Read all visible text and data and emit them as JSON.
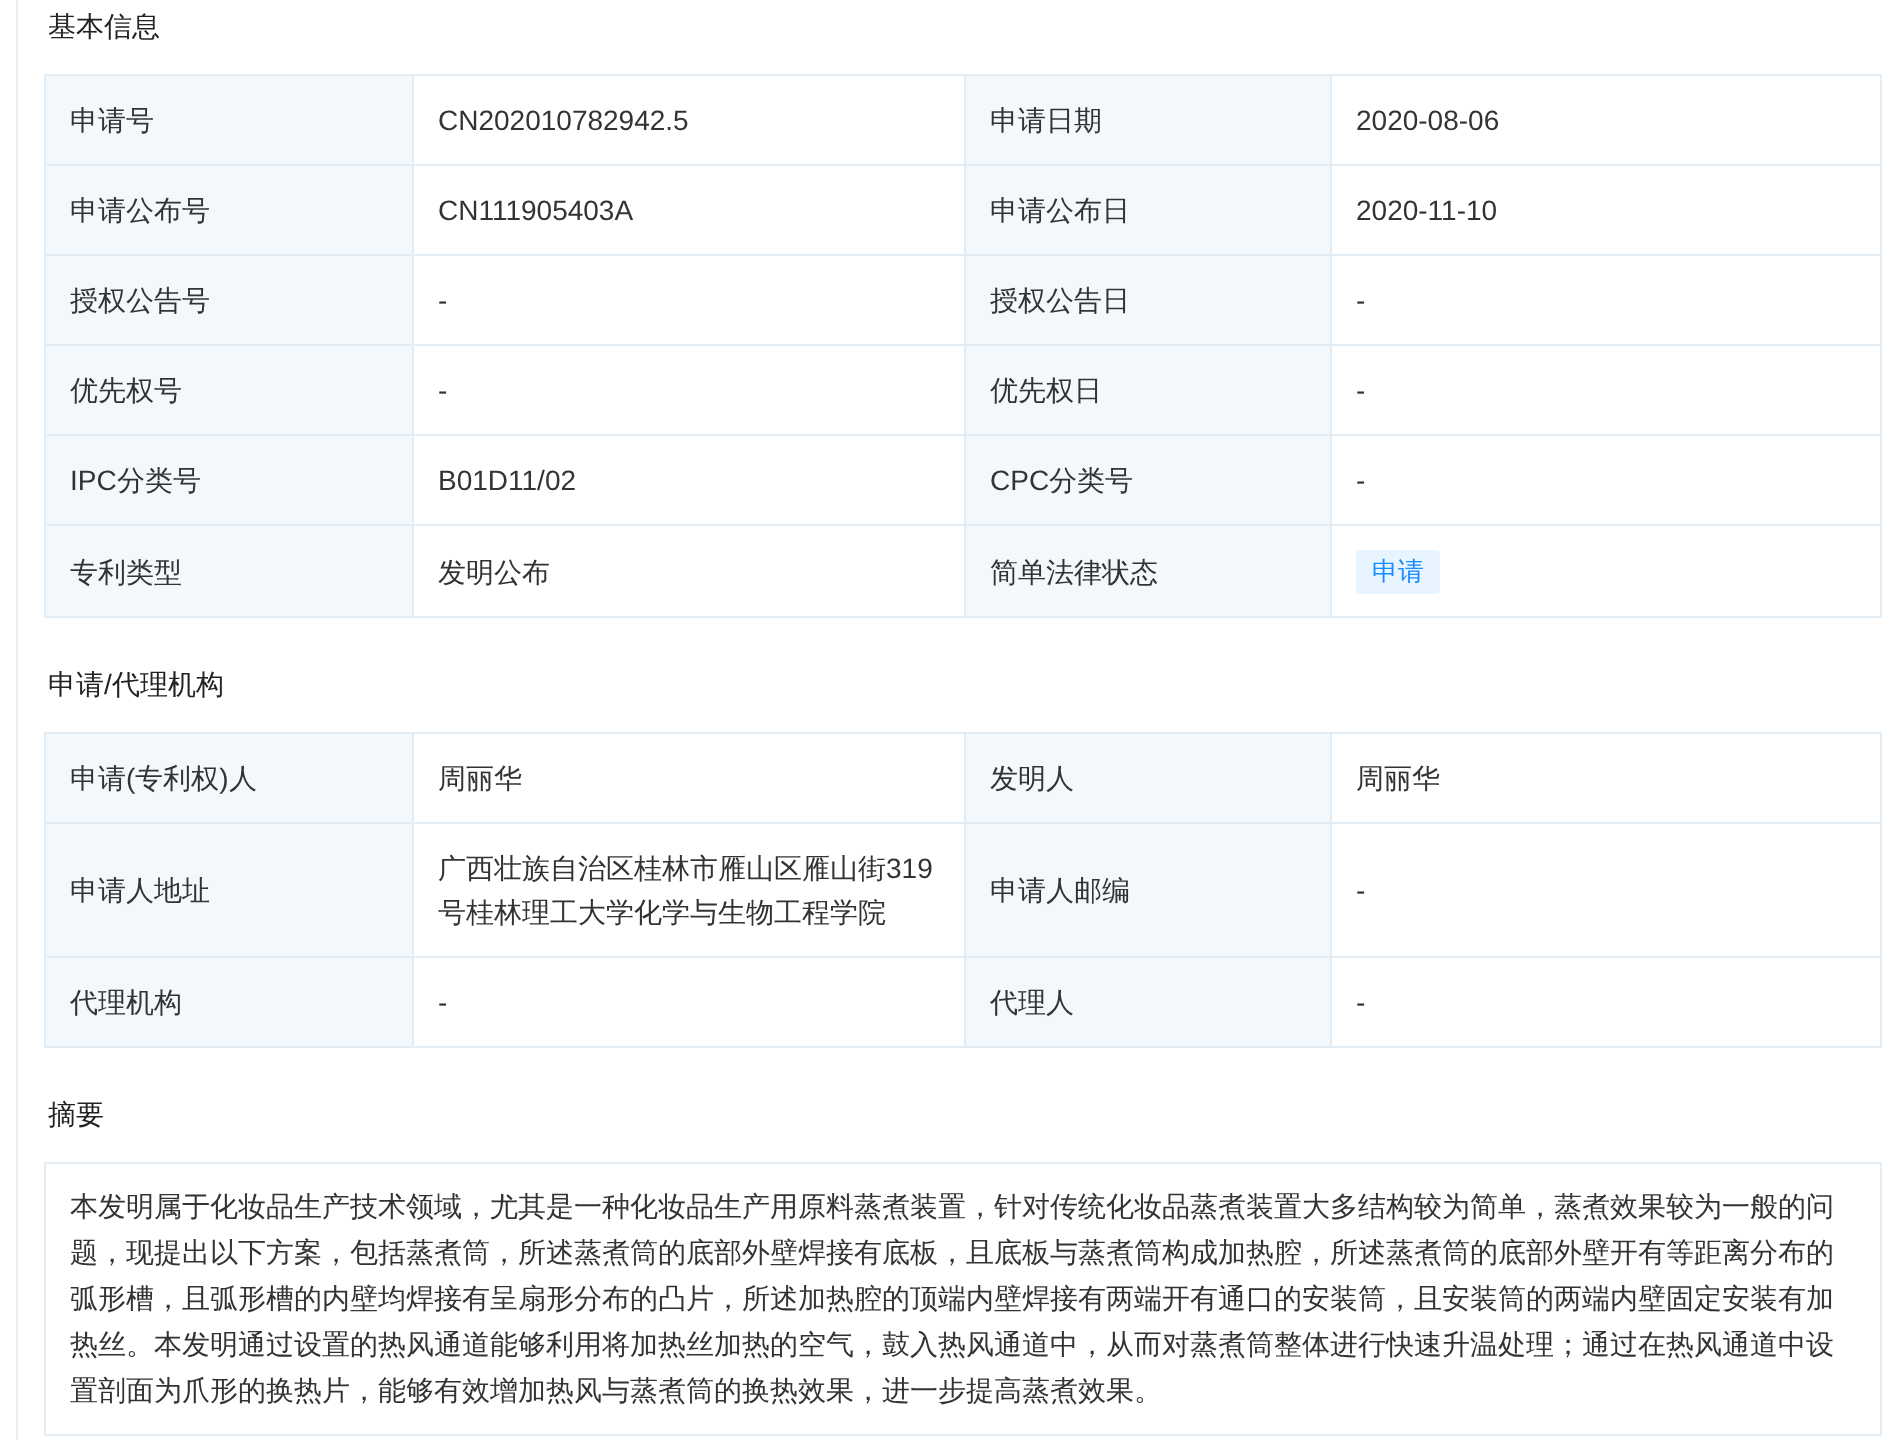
{
  "sections": [
    {
      "title": "基本信息",
      "kind": "table",
      "rows": [
        {
          "fields": [
            {
              "label": "申请号",
              "value": "CN202010782942.5",
              "kind": "text"
            },
            {
              "label": "申请日期",
              "value": "2020-08-06",
              "kind": "text"
            }
          ]
        },
        {
          "fields": [
            {
              "label": "申请公布号",
              "value": "CN111905403A",
              "kind": "text"
            },
            {
              "label": "申请公布日",
              "value": "2020-11-10",
              "kind": "text"
            }
          ]
        },
        {
          "fields": [
            {
              "label": "授权公告号",
              "value": "-",
              "kind": "text"
            },
            {
              "label": "授权公告日",
              "value": "-",
              "kind": "text"
            }
          ]
        },
        {
          "fields": [
            {
              "label": "优先权号",
              "value": "-",
              "kind": "text"
            },
            {
              "label": "优先权日",
              "value": "-",
              "kind": "text"
            }
          ]
        },
        {
          "fields": [
            {
              "label": "IPC分类号",
              "value": "B01D11/02",
              "kind": "text"
            },
            {
              "label": "CPC分类号",
              "value": "-",
              "kind": "text"
            }
          ]
        },
        {
          "fields": [
            {
              "label": "专利类型",
              "value": "发明公布",
              "kind": "text"
            },
            {
              "label": "简单法律状态",
              "value": "申请",
              "kind": "tag"
            }
          ]
        }
      ]
    },
    {
      "title": "申请/代理机构",
      "kind": "table",
      "rows": [
        {
          "fields": [
            {
              "label": "申请(专利权)人",
              "value": "周丽华",
              "kind": "text"
            },
            {
              "label": "发明人",
              "value": "周丽华",
              "kind": "text"
            }
          ]
        },
        {
          "fields": [
            {
              "label": "申请人地址",
              "value": "广西壮族自治区桂林市雁山区雁山街319号桂林理工大学化学与生物工程学院",
              "kind": "text"
            },
            {
              "label": "申请人邮编",
              "value": "-",
              "kind": "text"
            }
          ]
        },
        {
          "fields": [
            {
              "label": "代理机构",
              "value": "-",
              "kind": "text"
            },
            {
              "label": "代理人",
              "value": "-",
              "kind": "text"
            }
          ]
        }
      ]
    },
    {
      "title": "摘要",
      "kind": "text",
      "text": "本发明属于化妆品生产技术领域，尤其是一种化妆品生产用原料蒸煮装置，针对传统化妆品蒸煮装置大多结构较为简单，蒸煮效果较为一般的问题，现提出以下方案，包括蒸煮筒，所述蒸煮筒的底部外壁焊接有底板，且底板与蒸煮筒构成加热腔，所述蒸煮筒的底部外壁开有等距离分布的弧形槽，且弧形槽的内壁均焊接有呈扇形分布的凸片，所述加热腔的顶端内壁焊接有两端开有通口的安装筒，且安装筒的两端内壁固定安装有加热丝。本发明通过设置的热风通道能够利用将加热丝加热的空气，鼓入热风通道中，从而对蒸煮筒整体进行快速升温处理；通过在热风通道中设置剖面为爪形的换热片，能够有效增加热风与蒸煮筒的换热效果，进一步提高蒸煮效果。"
    }
  ]
}
